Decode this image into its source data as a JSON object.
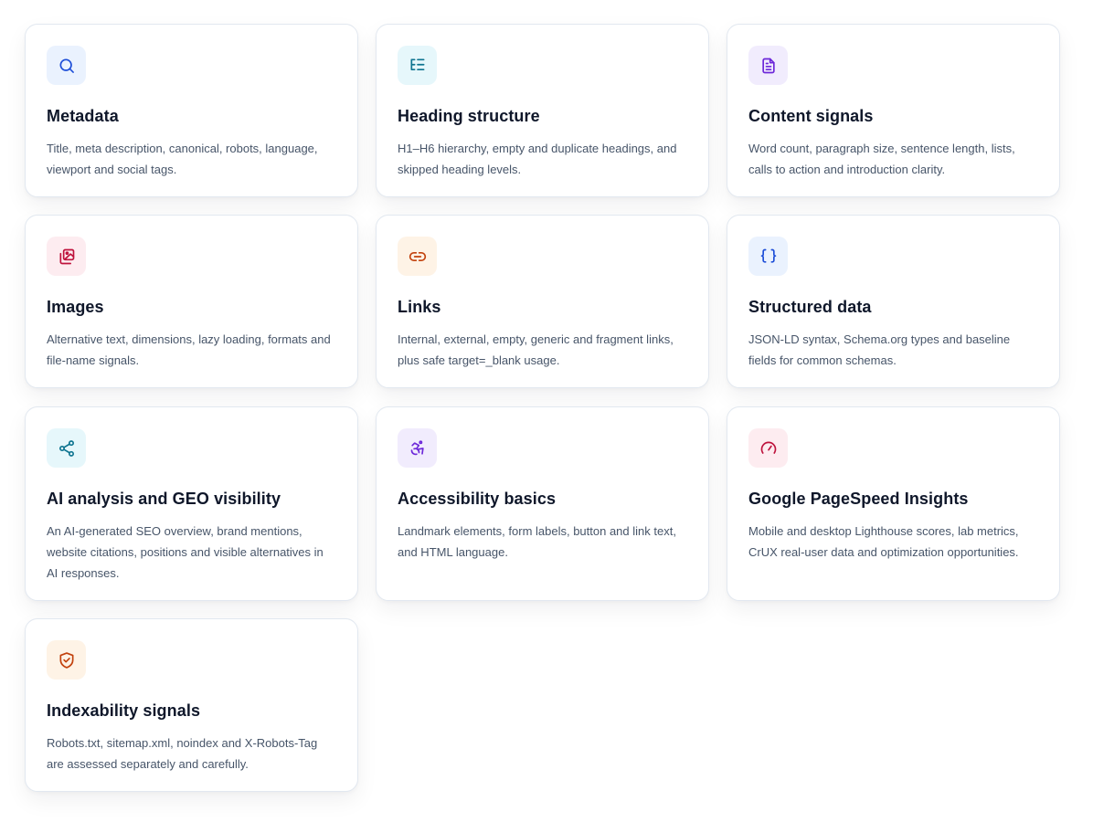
{
  "cards": [
    {
      "title": "Metadata",
      "description": "Title, meta description, canonical, robots, language, viewport and social tags.",
      "icon": "search-icon",
      "accent": "#1d4ed8"
    },
    {
      "title": "Heading structure",
      "description": "H1–H6 hierarchy, empty and duplicate headings, and skipped heading levels.",
      "icon": "list-tree-icon",
      "accent": "#0e7490"
    },
    {
      "title": "Content signals",
      "description": "Word count, paragraph size, sentence length, lists, calls to action and introduction clarity.",
      "icon": "document-icon",
      "accent": "#6d28d9"
    },
    {
      "title": "Images",
      "description": "Alternative text, dimensions, lazy loading, formats and file-name signals.",
      "icon": "images-icon",
      "accent": "#be123c"
    },
    {
      "title": "Links",
      "description": "Internal, external, empty, generic and fragment links, plus safe target=_blank usage.",
      "icon": "link-icon",
      "accent": "#c2410c"
    },
    {
      "title": "Structured data",
      "description": "JSON-LD syntax, Schema.org types and baseline fields for common schemas.",
      "icon": "braces-icon",
      "accent": "#1d4ed8"
    },
    {
      "title": "AI analysis and GEO visibility",
      "description": "An AI-generated SEO overview, brand mentions, website citations, positions and visible alternatives in AI responses.",
      "icon": "share-icon",
      "accent": "#0e7490"
    },
    {
      "title": "Accessibility basics",
      "description": "Landmark elements, form labels, button and link text, and HTML language.",
      "icon": "accessibility-icon",
      "accent": "#6d28d9"
    },
    {
      "title": "Google PageSpeed Insights",
      "description": "Mobile and desktop Lighthouse scores, lab metrics, CrUX real-user data and optimization opportunities.",
      "icon": "gauge-icon",
      "accent": "#be123c"
    },
    {
      "title": "Indexability signals",
      "description": "Robots.txt, sitemap.xml, noindex and X-Robots-Tag are assessed separately and carefully.",
      "icon": "shield-check-icon",
      "accent": "#c2410c"
    }
  ]
}
